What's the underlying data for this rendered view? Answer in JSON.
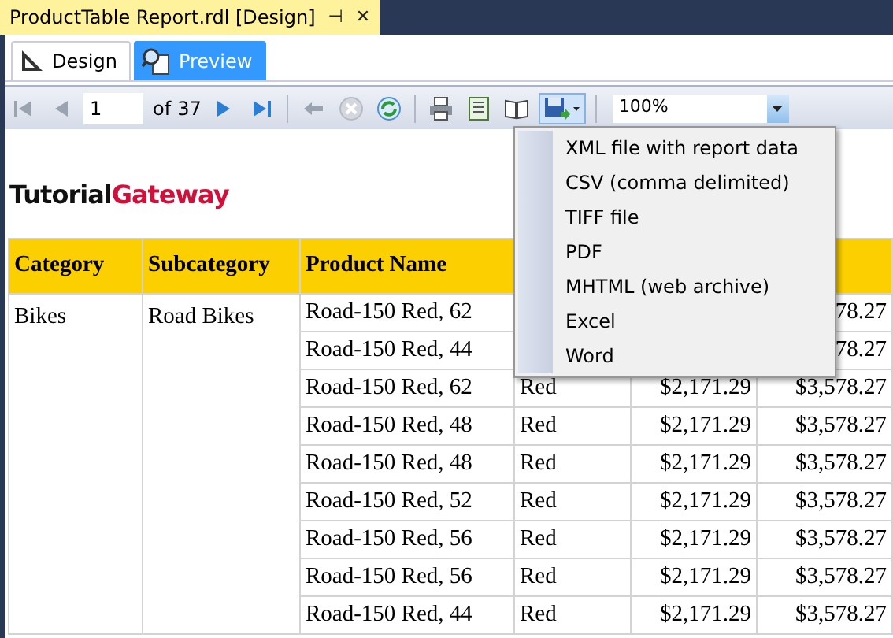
{
  "document_tab": {
    "title": "ProductTable Report.rdl [Design]",
    "pin": "⊣",
    "close": "✕"
  },
  "view_tabs": [
    {
      "label": "Design",
      "kind": "design",
      "selected": false
    },
    {
      "label": "Preview",
      "kind": "preview",
      "selected": true
    }
  ],
  "toolbar": {
    "page": "1",
    "of_label": "of",
    "page_count": "37",
    "zoom": "100%"
  },
  "export_menu": [
    "XML file with report data",
    "CSV (comma delimited)",
    "TIFF file",
    "PDF",
    "MHTML (web archive)",
    "Excel",
    "Word"
  ],
  "logo": [
    {
      "text": "Tutorial",
      "color": "#111111"
    },
    {
      "text": "Gateway",
      "color": "#d0103a"
    }
  ],
  "table": {
    "columns": [
      "Category",
      "Subcategory",
      "Product Name"
    ],
    "category": "Bikes",
    "subcategory": "Road Bikes",
    "rows": [
      {
        "product": "Road-150 Red, 62",
        "column_6": "78.27"
      },
      {
        "product": "Road-150 Red, 44",
        "column_6": "78.27"
      },
      {
        "product": "Road-150 Red, 62",
        "column_4": "Red",
        "column_5": "$2,171.29",
        "column_6": "$3,578.27"
      },
      {
        "product": "Road-150 Red, 48",
        "column_4": "Red",
        "column_5": "$2,171.29",
        "column_6": "$3,578.27"
      },
      {
        "product": "Road-150 Red, 48",
        "column_4": "Red",
        "column_5": "$2,171.29",
        "column_6": "$3,578.27"
      },
      {
        "product": "Road-150 Red, 52",
        "column_4": "Red",
        "column_5": "$2,171.29",
        "column_6": "$3,578.27"
      },
      {
        "product": "Road-150 Red, 56",
        "column_4": "Red",
        "column_5": "$2,171.29",
        "column_6": "$3,578.27"
      },
      {
        "product": "Road-150 Red, 56",
        "column_4": "Red",
        "column_5": "$2,171.29",
        "column_6": "$3,578.27"
      },
      {
        "product": "Road-150 Red, 44",
        "column_4": "Red",
        "column_5": "$2,171.29",
        "column_6": "$3,578.27"
      }
    ]
  }
}
